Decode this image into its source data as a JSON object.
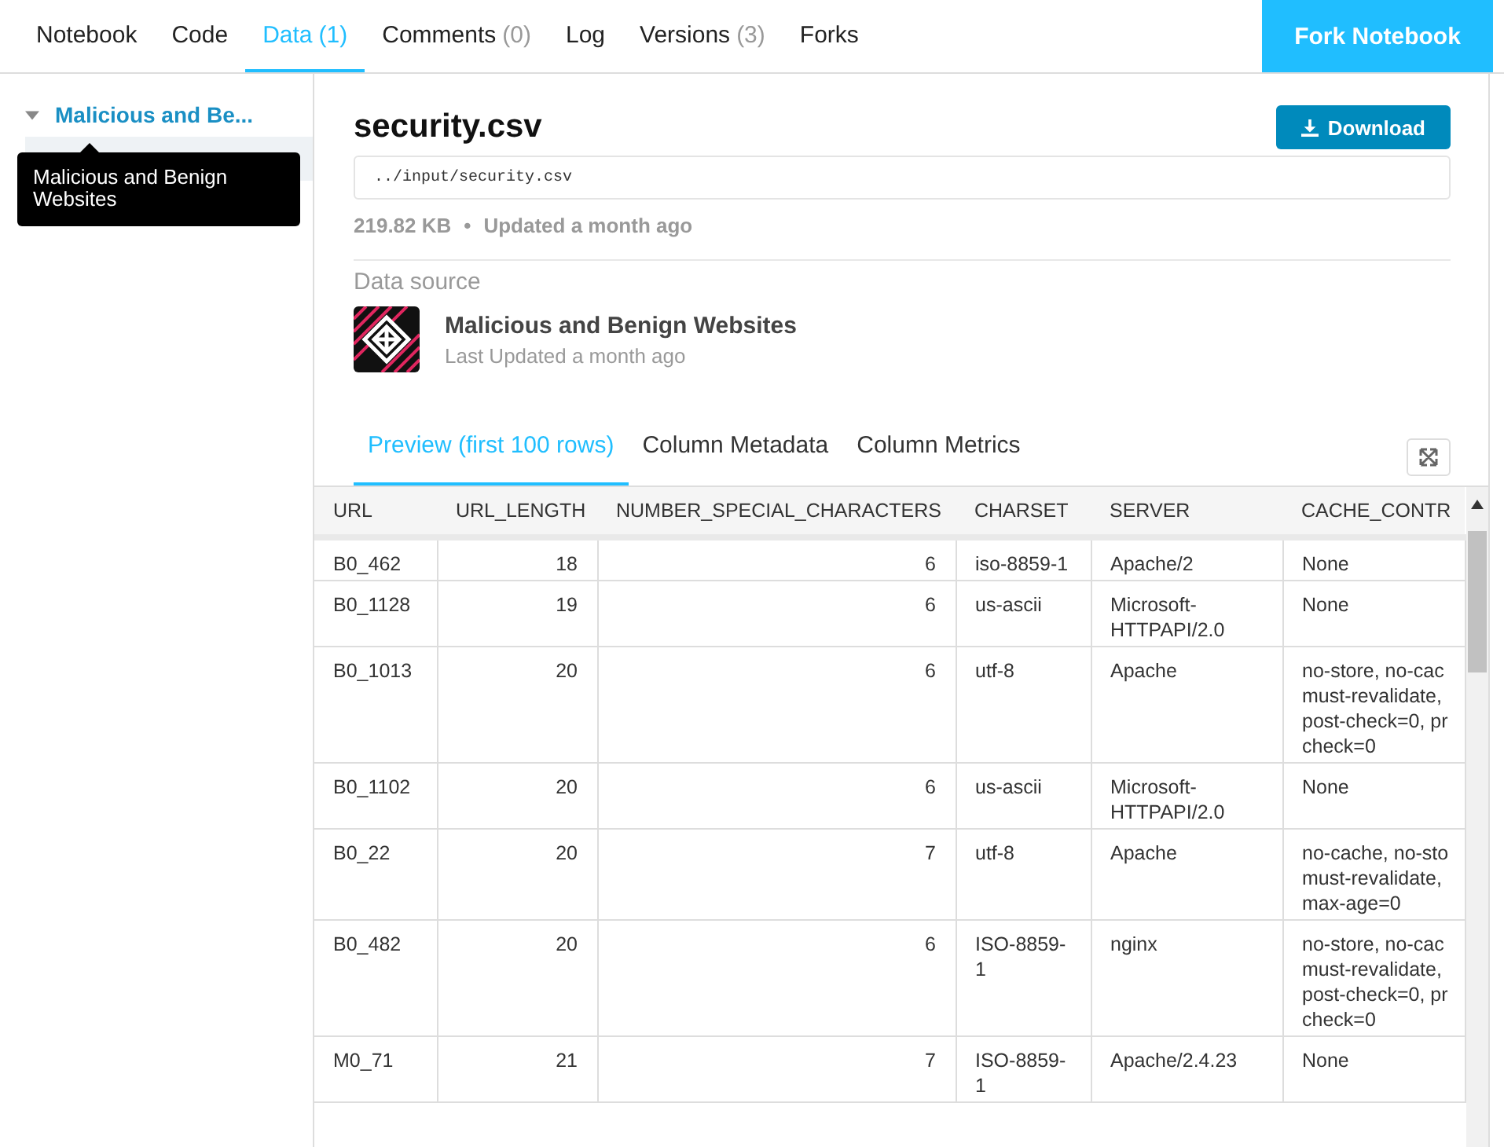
{
  "nav": {
    "tabs": [
      {
        "label": "Notebook",
        "selected": false
      },
      {
        "label": "Code",
        "selected": false
      },
      {
        "label": "Data",
        "count": "(1)",
        "selected": true
      },
      {
        "label": "Comments",
        "count": "(0)",
        "selected": false
      },
      {
        "label": "Log",
        "selected": false
      },
      {
        "label": "Versions",
        "count": "(3)",
        "selected": false
      },
      {
        "label": "Forks",
        "selected": false
      }
    ],
    "action": "Fork Notebook"
  },
  "sidebar": {
    "tree": [
      {
        "label": "Malicious and Be...",
        "expanded": true,
        "children": [
          {
            "selected": true
          }
        ]
      }
    ],
    "tooltip": "Malicious and Benign Websites"
  },
  "file": {
    "name": "security.csv",
    "download": "Download",
    "path": "../input/security.csv",
    "size": "219.82 KB",
    "separator": "•",
    "updated": "Updated a month ago"
  },
  "source": {
    "heading": "Data source",
    "title": "Malicious and Benign Websites",
    "subtitle": "Last Updated a month ago"
  },
  "preview_tabs": [
    {
      "label": "Preview (first 100 rows)",
      "selected": true
    },
    {
      "label": "Column Metadata",
      "selected": false
    },
    {
      "label": "Column Metrics",
      "selected": false
    }
  ],
  "table": {
    "columns": [
      {
        "label": "URL",
        "kind": "text"
      },
      {
        "label": "URL_LENGTH",
        "kind": "number"
      },
      {
        "label": "NUMBER_SPECIAL_CHARACTERS",
        "kind": "number"
      },
      {
        "label": "CHARSET",
        "kind": "text"
      },
      {
        "label": "SERVER",
        "kind": "text"
      },
      {
        "label": "CACHE_CONTR",
        "kind": "text"
      }
    ],
    "rows": [
      [
        "B0_462",
        "18",
        "6",
        "iso-8859-1",
        "Apache/2",
        "None"
      ],
      [
        "B0_1128",
        "19",
        "6",
        "us-ascii",
        "Microsoft-HTTPAPI/2.0",
        "None"
      ],
      [
        "B0_1013",
        "20",
        "6",
        "utf-8",
        "Apache",
        "no-store, no-cac\nmust-revalidate,\npost-check=0, pr\ncheck=0"
      ],
      [
        "B0_1102",
        "20",
        "6",
        "us-ascii",
        "Microsoft-HTTPAPI/2.0",
        "None"
      ],
      [
        "B0_22",
        "20",
        "7",
        "utf-8",
        "Apache",
        "no-cache, no-sto\nmust-revalidate,\nmax-age=0"
      ],
      [
        "B0_482",
        "20",
        "6",
        "ISO-8859-1",
        "nginx",
        "no-store, no-cac\nmust-revalidate,\npost-check=0, pr\ncheck=0"
      ],
      [
        "M0_71",
        "21",
        "7",
        "ISO-8859-1",
        "Apache/2.4.23",
        "None"
      ]
    ]
  }
}
